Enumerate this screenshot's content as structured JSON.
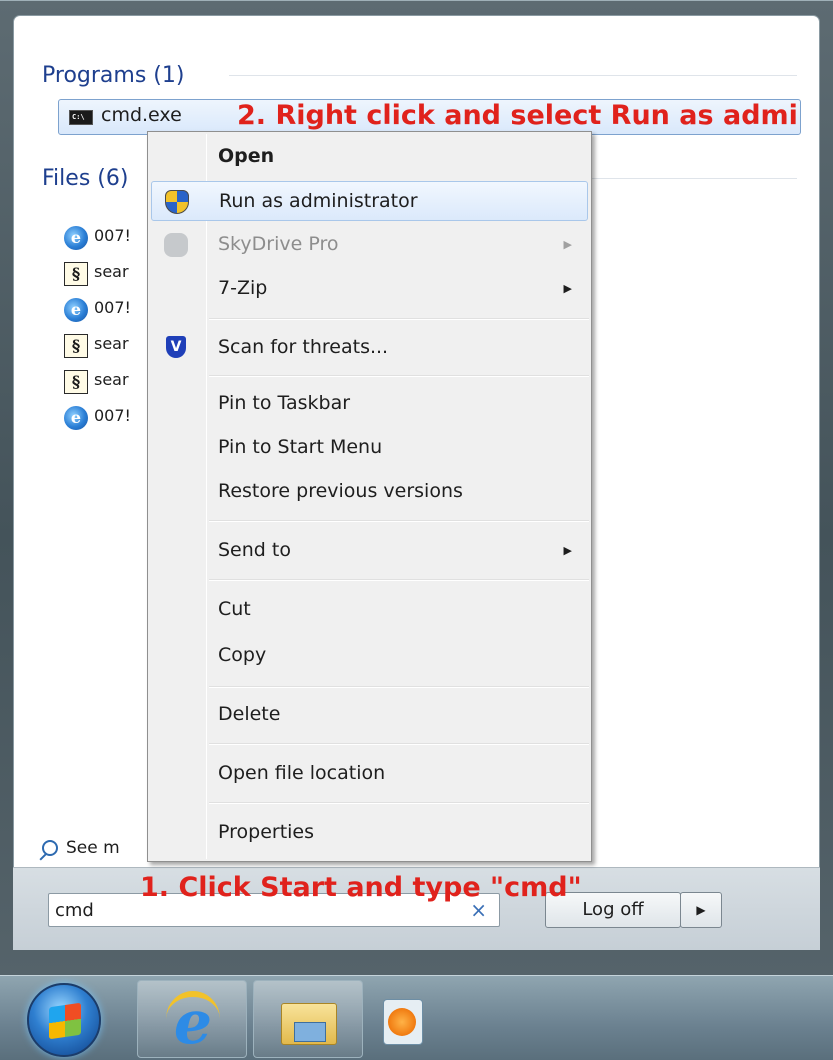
{
  "start_menu": {
    "programs_header": "Programs (1)",
    "program_item": {
      "icon": "cmd-icon",
      "icon_text": "C:\\",
      "label": "cmd.exe"
    },
    "files_header": "Files (6)",
    "files": [
      {
        "icon": "ie-icon",
        "label": "007!"
      },
      {
        "icon": "script-icon",
        "label": "sear"
      },
      {
        "icon": "ie-icon",
        "label": "007!"
      },
      {
        "icon": "script-icon",
        "label": "sear"
      },
      {
        "icon": "script-icon",
        "label": "sear"
      },
      {
        "icon": "ie-icon",
        "label": "007!"
      }
    ],
    "see_more": "See m",
    "search": {
      "value": "cmd",
      "clear_glyph": "×"
    },
    "logoff_label": "Log off",
    "logoff_arrow": "▶"
  },
  "annotations": {
    "step1": "1. Click Start and type \"cmd\"",
    "step2": "2. Right click and select Run as admi"
  },
  "context_menu": {
    "items": [
      {
        "label": "Open",
        "bold": true
      },
      {
        "label": "Run as administrator",
        "icon": "uac-shield-icon",
        "highlighted": true
      },
      {
        "label": "SkyDrive Pro",
        "icon": "skydrive-cloud-icon",
        "disabled": true,
        "submenu": "▶"
      },
      {
        "label": "7-Zip",
        "submenu": "▶"
      },
      {
        "label": "Scan for threats...",
        "icon": "antivirus-icon"
      },
      {
        "label": "Pin to Taskbar"
      },
      {
        "label": "Pin to Start Menu"
      },
      {
        "label": "Restore previous versions"
      },
      {
        "label": "Send to",
        "submenu": "▶"
      },
      {
        "label": "Cut"
      },
      {
        "label": "Copy"
      },
      {
        "label": "Delete"
      },
      {
        "label": "Open file location"
      },
      {
        "label": "Properties"
      }
    ]
  },
  "taskbar": {
    "start_orb": "windows-start-orb-icon",
    "pinned": [
      "internet-explorer-icon",
      "windows-explorer-icon",
      "media-player-icon"
    ]
  },
  "colors": {
    "annotation_red": "#e0221c",
    "header_blue": "#1e3f8e",
    "menu_highlight": "#dbe9fb"
  }
}
